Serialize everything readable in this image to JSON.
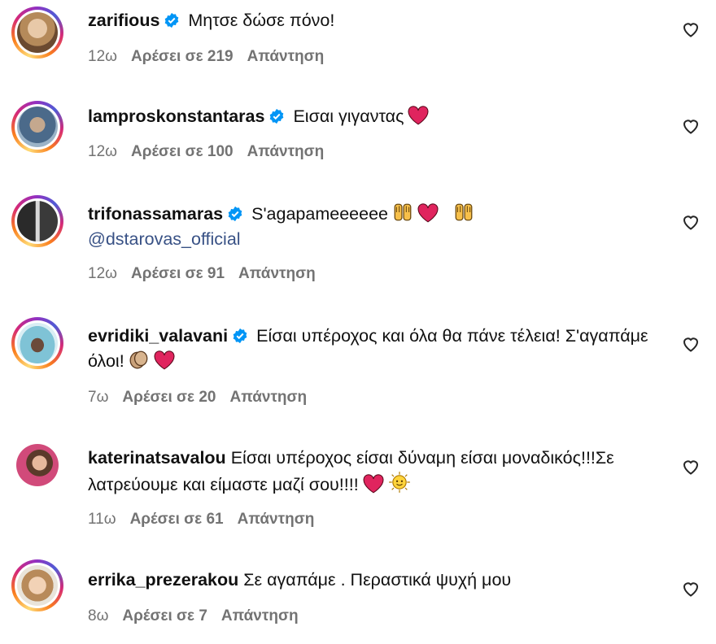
{
  "comments": [
    {
      "user": "zarifious",
      "text": "Μητσε δώσε πόνο!",
      "time": "12ω",
      "likes": "Αρέσει σε 219",
      "reply": "Απάντηση"
    },
    {
      "user": "lamproskonstantaras",
      "text": "Εισαι γιγαντας",
      "time": "12ω",
      "likes": "Αρέσει σε 100",
      "reply": "Απάντηση"
    },
    {
      "user": "trifonassamaras",
      "text": "S'agapameeeeee",
      "mention": "@dstarovas_official",
      "time": "12ω",
      "likes": "Αρέσει σε 91",
      "reply": "Απάντηση"
    },
    {
      "user": "evridiki_valavani",
      "text": "Είσαι υπέροχος και όλα θα πάνε τέλεια! Σ'αγαπάμε όλοι!",
      "time": "7ω",
      "likes": "Αρέσει σε 20",
      "reply": "Απάντηση"
    },
    {
      "user": "katerinatsavalou",
      "text": "Είσαι υπέροχος είσαι δύναμη είσαι μοναδικός!!!Σε λατρεύουμε και είμαστε μαζί σου!!!!",
      "time": "11ω",
      "likes": "Αρέσει σε 61",
      "reply": "Απάντηση"
    },
    {
      "user": "errika_prezerakou",
      "text": "Σε αγαπάμε . Περαστικά ψυχή μου",
      "time": "8ω",
      "likes": "Αρέσει σε 7",
      "reply": "Απάντηση"
    }
  ],
  "colors": {
    "meta": "#737373",
    "verified": "#0095f6",
    "mention": "#385185",
    "heart_emoji": "#e0245e"
  }
}
